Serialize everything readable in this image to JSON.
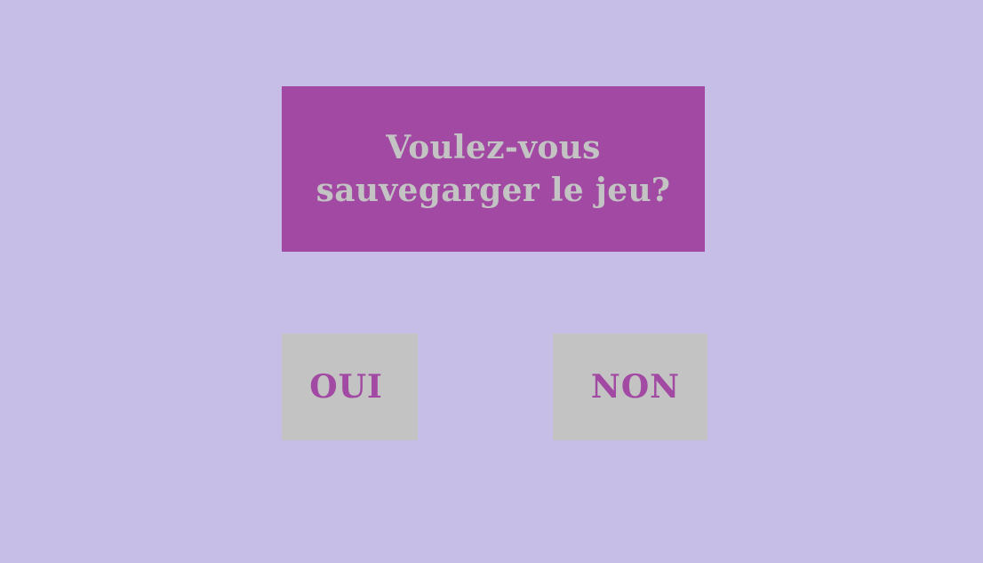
{
  "dialog": {
    "question_line1": "Voulez-vous",
    "question_line2": "sauvegarger le jeu?"
  },
  "buttons": {
    "yes_label": "OUI",
    "no_label": "NON"
  },
  "colors": {
    "background": "#c6bee6",
    "panel": "#a24aa3",
    "button": "#c3c3c3",
    "panel_text": "#c3c3c3",
    "button_text": "#a24aa3"
  }
}
